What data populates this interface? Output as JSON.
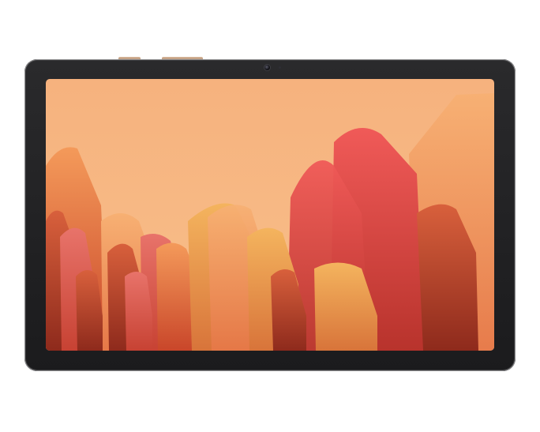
{
  "device": {
    "name": "tablet",
    "frame_color": "#1f1f21",
    "accent_color": "#c9a27e"
  },
  "wallpaper": {
    "sky_color": "#f7b784",
    "petal_colors": [
      "#f4a06a",
      "#e8673e",
      "#e04b4c",
      "#d74a3f",
      "#f0a34e",
      "#f29a5c"
    ]
  }
}
